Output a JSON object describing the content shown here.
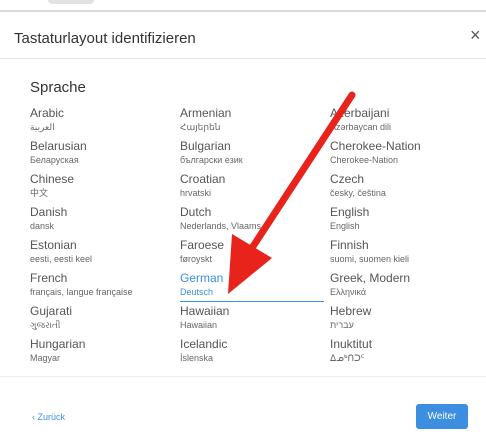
{
  "dialog": {
    "title": "Tastaturlayout identifizieren",
    "close_symbol": "×",
    "section_label": "Sprache",
    "back_label": "‹ Zurück",
    "next_label": "Weiter"
  },
  "languages": [
    {
      "name": "Arabic",
      "native": "العربية"
    },
    {
      "name": "Armenian",
      "native": "Հայերեն"
    },
    {
      "name": "Azerbaijani",
      "native": "Azərbaycan dili"
    },
    {
      "name": "Belarusian",
      "native": "Беларуская"
    },
    {
      "name": "Bulgarian",
      "native": "български език"
    },
    {
      "name": "Cherokee-Nation",
      "native": "Cherokee-Nation"
    },
    {
      "name": "Chinese",
      "native": "中文"
    },
    {
      "name": "Croatian",
      "native": "hrvatski"
    },
    {
      "name": "Czech",
      "native": "česky, čeština"
    },
    {
      "name": "Danish",
      "native": "dansk"
    },
    {
      "name": "Dutch",
      "native": "Nederlands, Vlaams"
    },
    {
      "name": "English",
      "native": "English"
    },
    {
      "name": "Estonian",
      "native": "eesti, eesti keel"
    },
    {
      "name": "Faroese",
      "native": "føroyskt"
    },
    {
      "name": "Finnish",
      "native": "suomi, suomen kieli"
    },
    {
      "name": "French",
      "native": "français, langue française"
    },
    {
      "name": "German",
      "native": "Deutsch",
      "selected": true
    },
    {
      "name": "Greek, Modern",
      "native": "Ελληνικά"
    },
    {
      "name": "Gujarati",
      "native": "ગુજરાતી"
    },
    {
      "name": "Hawaiian",
      "native": "Hawaiian"
    },
    {
      "name": "Hebrew",
      "native": "עברית"
    },
    {
      "name": "Hungarian",
      "native": "Magyar"
    },
    {
      "name": "Icelandic",
      "native": "Íslenska"
    },
    {
      "name": "Inuktitut",
      "native": "ᐃᓄᒃᑎᑐᑦ"
    }
  ],
  "colors": {
    "accent": "#3b8ee0",
    "annotation_arrow": "#e8231b"
  }
}
